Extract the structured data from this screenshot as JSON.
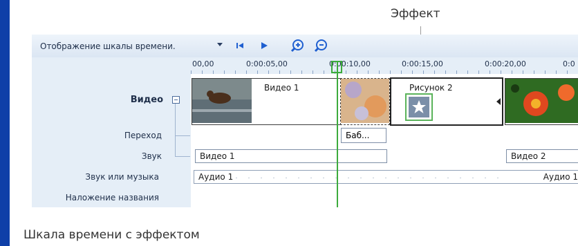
{
  "callout": {
    "label": "Эффект"
  },
  "toolbar": {
    "view_label": "Отображение шкалы времени.",
    "dropdown_icon": "chevron-down-icon",
    "buttons": [
      "skip-to-start-icon",
      "play-icon",
      "zoom-in-icon",
      "zoom-out-icon"
    ]
  },
  "ruler": {
    "ticks": [
      "00,00",
      "0:00:05,00",
      "0:00:10,00",
      "0:00:15,00",
      "0:00:20,00",
      "0:0"
    ]
  },
  "rows": {
    "video": "Видео",
    "transition": "Переход",
    "audio": "Звук",
    "audio_music": "Звук или музыка",
    "title_overlay": "Наложение названия"
  },
  "clips": {
    "video1": "Видео 1",
    "picture2": "Рисунок 2"
  },
  "transition": {
    "label": "Баб..."
  },
  "audio_track": {
    "clip1": "Видео 1",
    "clip2": "Видео 2"
  },
  "music_track": {
    "clip1": "Аудио 1",
    "clip2": "Аудио 1"
  },
  "caption": "Шкала времени с эффектом",
  "colors": {
    "accent_blue": "#0f3fa8",
    "playhead_green": "#3cab3c",
    "panel_bg": "#e5eef7"
  }
}
